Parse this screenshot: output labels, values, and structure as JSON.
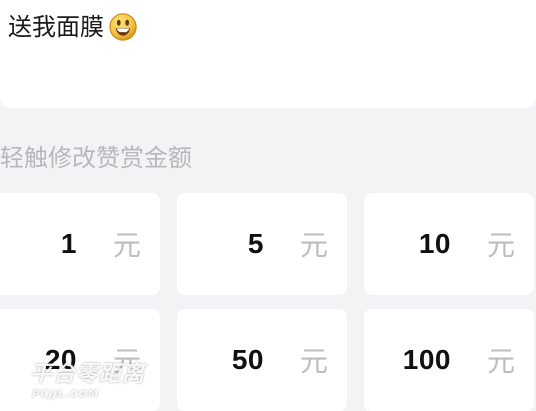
{
  "message": {
    "text": "送我面膜",
    "emoji": "grinning-face-icon"
  },
  "section": {
    "label": "轻触修改赞赏金额"
  },
  "amounts": [
    {
      "value": "1",
      "unit": "元"
    },
    {
      "value": "5",
      "unit": "元"
    },
    {
      "value": "10",
      "unit": "元"
    },
    {
      "value": "20",
      "unit": "元"
    },
    {
      "value": "50",
      "unit": "元"
    },
    {
      "value": "100",
      "unit": "元"
    }
  ],
  "watermark": {
    "brand": "平台零距离",
    "domain": "PCJJL.COM"
  },
  "colors": {
    "background": "#f3f3f5",
    "card": "#ffffff",
    "label": "#b8b8bc",
    "unit": "#bdbdbf",
    "text": "#111111"
  }
}
